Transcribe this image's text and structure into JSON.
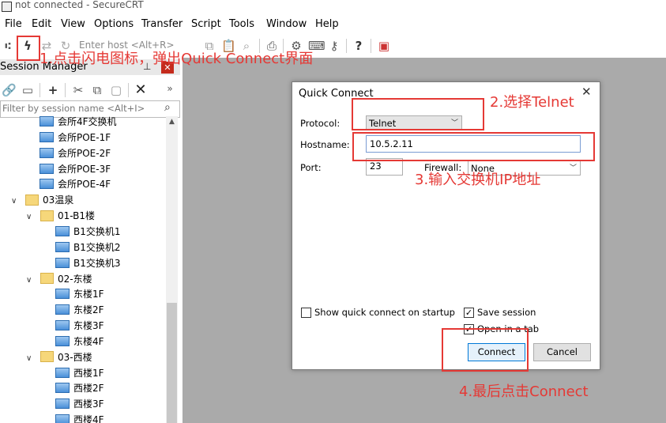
{
  "window": {
    "title": "not connected - SecureCRT"
  },
  "menu": [
    "File",
    "Edit",
    "View",
    "Options",
    "Transfer",
    "Script",
    "Tools",
    "Window",
    "Help"
  ],
  "toolbar": {
    "host_placeholder": "Enter host <Alt+R>"
  },
  "session_manager": {
    "title": "Session Manager",
    "pin": "ᵖ",
    "filter_placeholder": "Filter by session name <Alt+I>",
    "tree": [
      {
        "label": "会所4F交换机",
        "type": "session",
        "level": 2
      },
      {
        "label": "会所POE-1F",
        "type": "session",
        "level": 2
      },
      {
        "label": "会所POE-2F",
        "type": "session",
        "level": 2
      },
      {
        "label": "会所POE-3F",
        "type": "session",
        "level": 2
      },
      {
        "label": "会所POE-4F",
        "type": "session",
        "level": 2
      },
      {
        "label": "03温泉",
        "type": "folder",
        "level": 0
      },
      {
        "label": "01-B1楼",
        "type": "folder",
        "level": 1
      },
      {
        "label": "B1交换机1",
        "type": "session",
        "level": 2
      },
      {
        "label": "B1交换机2",
        "type": "session",
        "level": 2
      },
      {
        "label": "B1交换机3",
        "type": "session",
        "level": 2
      },
      {
        "label": "02-东楼",
        "type": "folder",
        "level": 1
      },
      {
        "label": "东楼1F",
        "type": "session",
        "level": 2
      },
      {
        "label": "东楼2F",
        "type": "session",
        "level": 2
      },
      {
        "label": "东楼3F",
        "type": "session",
        "level": 2
      },
      {
        "label": "东楼4F",
        "type": "session",
        "level": 2
      },
      {
        "label": "03-西楼",
        "type": "folder",
        "level": 1
      },
      {
        "label": "西楼1F",
        "type": "session",
        "level": 2
      },
      {
        "label": "西楼2F",
        "type": "session",
        "level": 2
      },
      {
        "label": "西楼3F",
        "type": "session",
        "level": 2
      },
      {
        "label": "西楼4F",
        "type": "session",
        "level": 2
      }
    ]
  },
  "quick_connect": {
    "title": "Quick Connect",
    "protocol_label": "Protocol:",
    "protocol_value": "Telnet",
    "hostname_label": "Hostname:",
    "hostname_value": "10.5.2.11",
    "port_label": "Port:",
    "port_value": "23",
    "firewall_label": "Firewall:",
    "firewall_value": "None",
    "show_on_startup_label": "Show quick connect on startup",
    "show_on_startup_checked": false,
    "save_session_label": "Save session",
    "save_session_checked": true,
    "open_in_tab_label": "Open in a tab",
    "open_in_tab_checked": true,
    "connect_label": "Connect",
    "cancel_label": "Cancel"
  },
  "annotations": {
    "step1": "1.点击闪电图标，弹出Quick Connect界面",
    "step2": "2.选择Telnet",
    "step3": "3.输入交换机IP地址",
    "step4": "4.最后点击Connect"
  },
  "colors": {
    "annotation": "#e53935",
    "workspace": "#aaaaaa",
    "close_red": "#c42b1c"
  }
}
